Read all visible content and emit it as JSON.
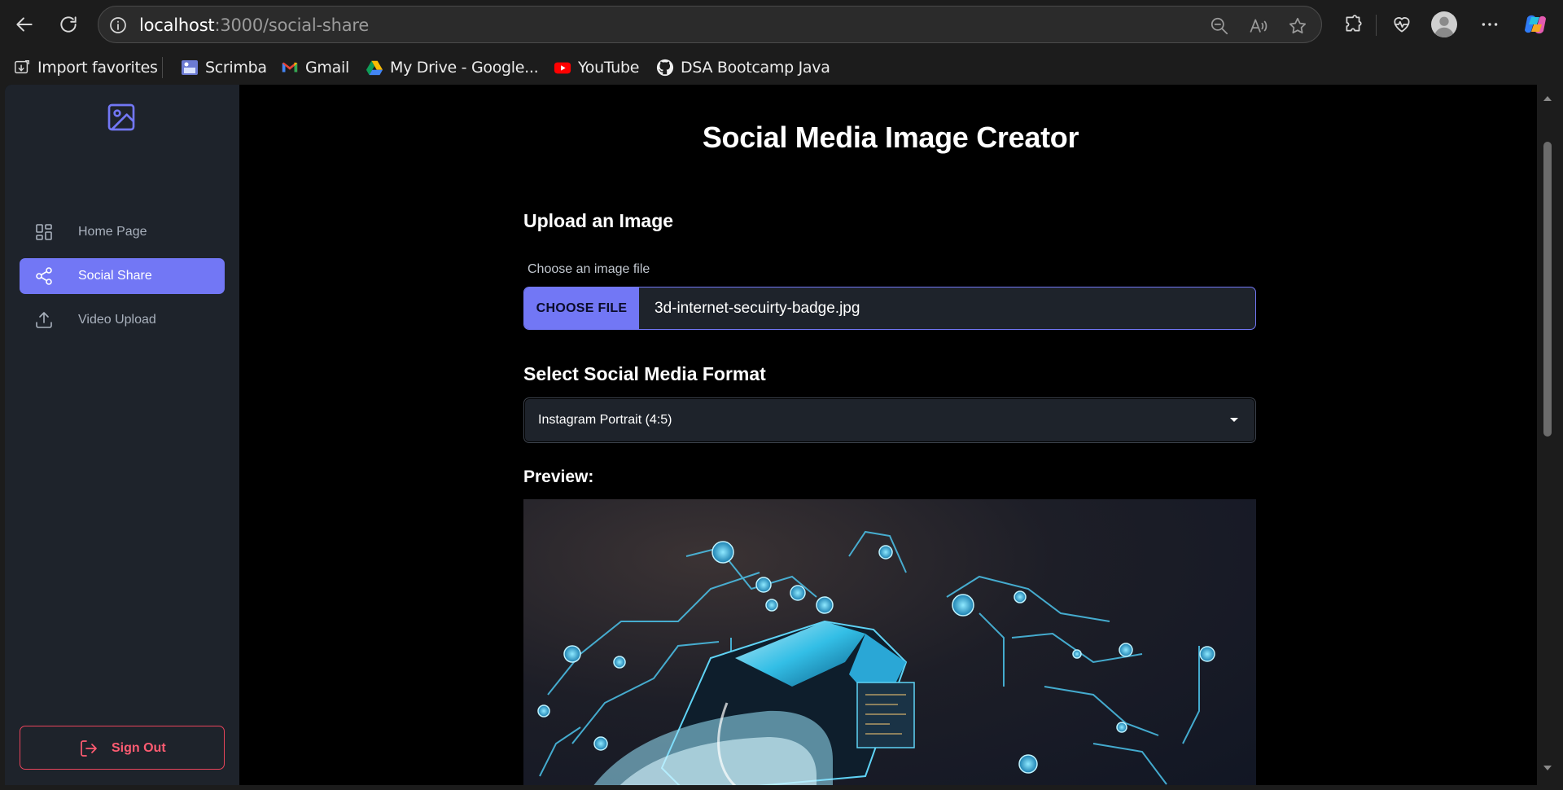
{
  "browser": {
    "url_host": "localhost",
    "url_path": ":3000/social-share",
    "bookmarks": [
      {
        "label": "Import favorites",
        "icon": "import-icon"
      },
      {
        "label": "Scrimba",
        "icon": "scrimba-icon"
      },
      {
        "label": "Gmail",
        "icon": "gmail-icon"
      },
      {
        "label": "My Drive - Google...",
        "icon": "drive-icon"
      },
      {
        "label": "YouTube",
        "icon": "youtube-icon"
      },
      {
        "label": "DSA Bootcamp Java",
        "icon": "github-icon"
      }
    ]
  },
  "sidebar": {
    "items": [
      {
        "label": "Home Page",
        "icon": "grid-icon"
      },
      {
        "label": "Social Share",
        "icon": "share-icon",
        "active": true
      },
      {
        "label": "Video Upload",
        "icon": "upload-icon"
      }
    ],
    "sign_out": "Sign Out"
  },
  "main": {
    "title": "Social Media Image Creator",
    "upload_heading": "Upload an Image",
    "file_label": "Choose an image file",
    "file_button": "CHOOSE FILE",
    "file_name": "3d-internet-secuirty-badge.jpg",
    "format_heading": "Select Social Media Format",
    "format_selected": "Instagram Portrait (4:5)",
    "preview_heading": "Preview:"
  },
  "colors": {
    "accent": "#7277f5",
    "sidebar_bg": "#1e232b",
    "danger": "#e8445b"
  }
}
